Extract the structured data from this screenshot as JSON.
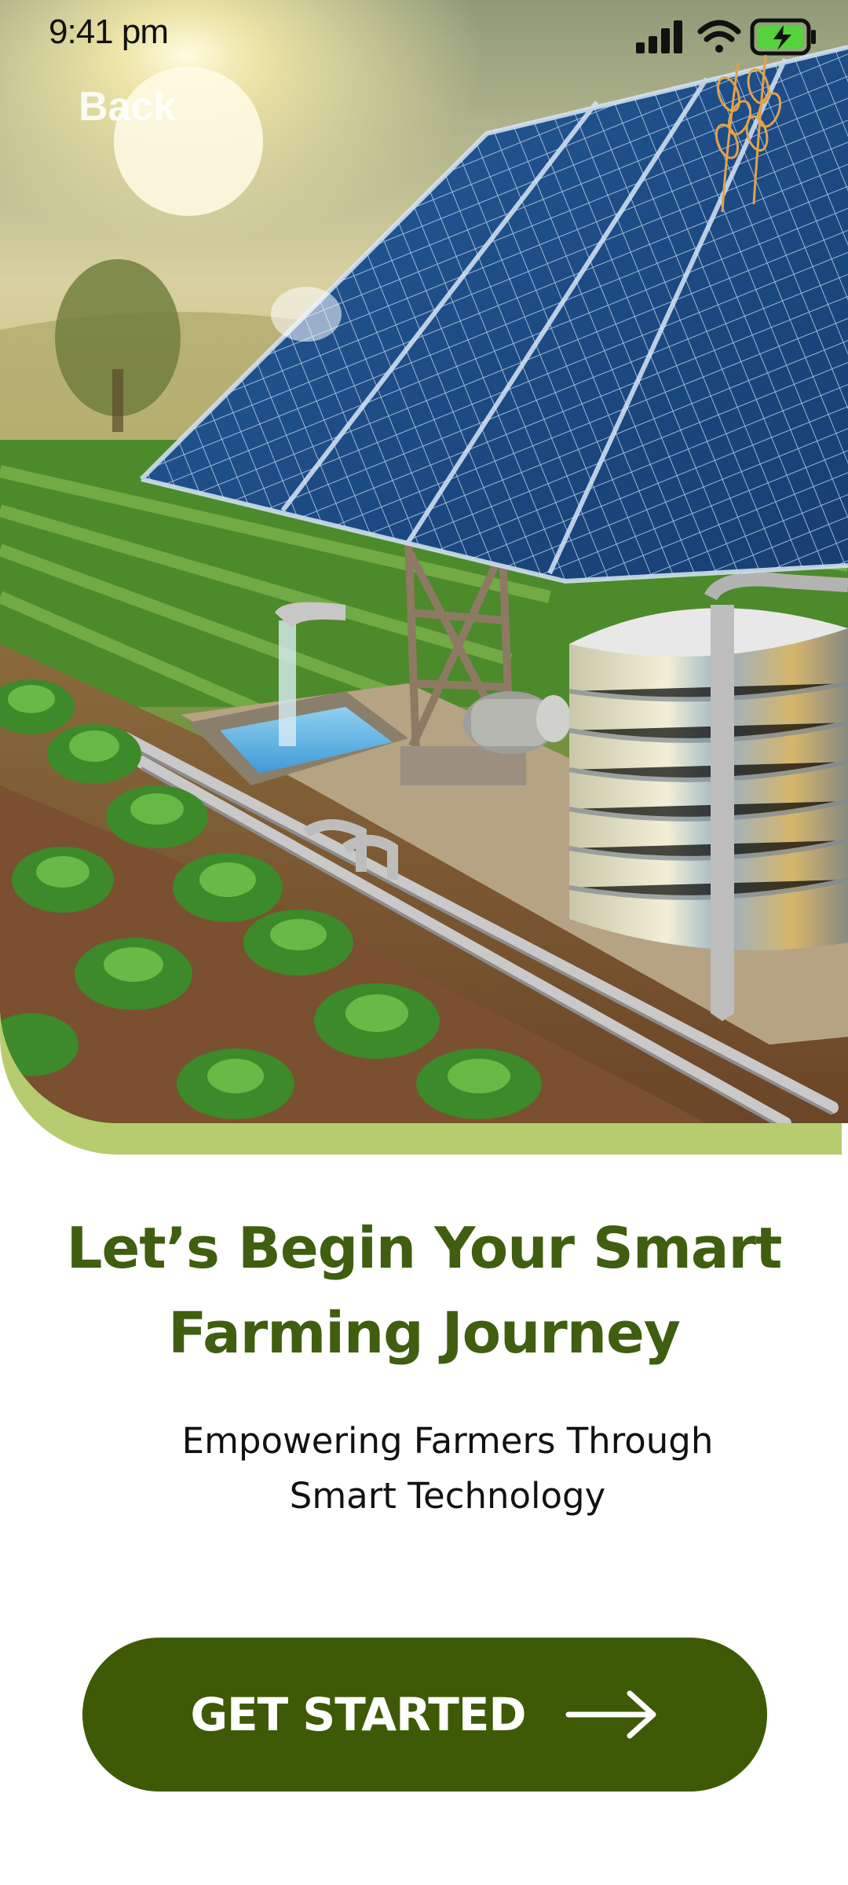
{
  "status_bar": {
    "time": "9:41 pm",
    "icons": [
      "signal-icon",
      "wifi-icon",
      "battery-charging-icon"
    ]
  },
  "nav": {
    "back_label": "Back"
  },
  "hero": {
    "image_subject": "solar-powered-irrigation-farm",
    "accent_color": "#b6cc6f"
  },
  "content": {
    "headline": "Let’s Begin Your Smart Farming Journey",
    "subhead": "Empowering Farmers Through Smart Technology"
  },
  "cta": {
    "label": "GET STARTED",
    "icon": "arrow-right-icon",
    "color": "#3f5a06"
  },
  "colors": {
    "headline": "#3f5e0f",
    "background": "#ffffff"
  }
}
